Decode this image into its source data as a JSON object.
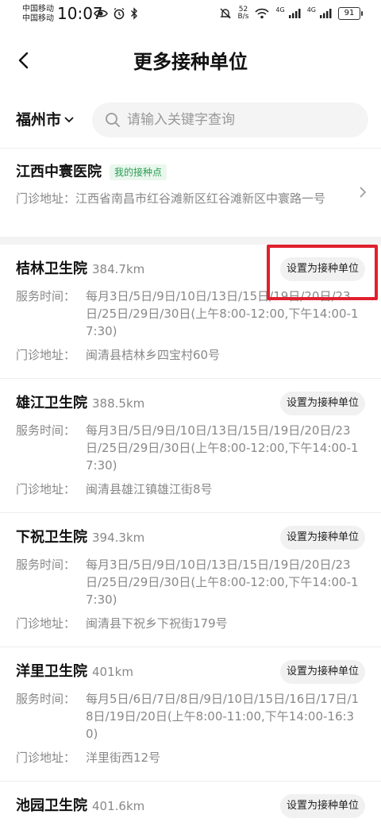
{
  "status_bar": {
    "carrier_1": "中国移动",
    "carrier_2": "中国移动",
    "time": "10:07",
    "net_speed_value": "52",
    "net_speed_unit": "B/s",
    "signal_label_1": "4G",
    "signal_label_2": "4G",
    "battery": "91"
  },
  "header": {
    "title": "更多接种单位"
  },
  "filter": {
    "city": "福州市",
    "search_placeholder": "请输入关键字查询"
  },
  "my_unit": {
    "name": "江西中寰医院",
    "badge": "我的接种点",
    "address_label": "门诊地址：",
    "address": "江西省南昌市红谷滩新区红谷滩新区中寰路一号"
  },
  "labels": {
    "service_time": "服务时间：",
    "address": "门诊地址：",
    "set_button": "设置为接种单位"
  },
  "units": [
    {
      "name": "桔林卫生院",
      "distance": "384.7km",
      "service_time": "每月3日/5日/9日/10日/13日/15日/19日/20日/23日/25日/29日/30日(上午8:00-12:00,下午14:00-17:30)",
      "address": "闽清县桔林乡四宝村60号"
    },
    {
      "name": "雄江卫生院",
      "distance": "388.5km",
      "service_time": "每月3日/5日/9日/10日/13日/15日/19日/20日/23日/25日/29日/30日(上午8:00-12:00,下午14:00-17:30)",
      "address": "闽清县雄江镇雄江街8号"
    },
    {
      "name": "下祝卫生院",
      "distance": "394.3km",
      "service_time": "每月3日/5日/9日/10日/13日/15日/19日/20日/23日/25日/29日/30日(上午8:00-12:00,下午14:00-17:30)",
      "address": "闽清县下祝乡下祝街179号"
    },
    {
      "name": "洋里卫生院",
      "distance": "401km",
      "service_time": "每月5日/6日/7日/8日/9日/10日/15日/16日/17日/18日/19日/20日(上午8:00-11:00,下午14:00-16:30)",
      "address": "洋里街西12号"
    },
    {
      "name": "池园卫生院",
      "distance": "401.6km",
      "service_time": "",
      "address": ""
    }
  ],
  "colors": {
    "highlight": "#e0202e",
    "badge_text": "#2a9d52",
    "badge_bg": "#eaf7ee"
  }
}
